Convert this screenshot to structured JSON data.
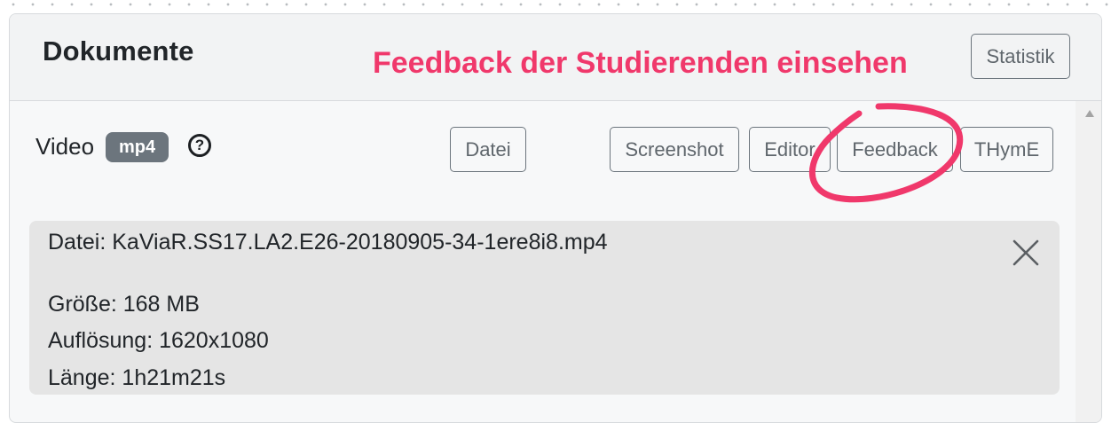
{
  "header": {
    "title": "Dokumente",
    "statistik_label": "Statistik"
  },
  "annotation": {
    "text": "Feedback der Studierenden einsehen",
    "color": "#f0386b"
  },
  "media": {
    "label": "Video",
    "badge": "mp4",
    "help_symbol": "?"
  },
  "buttons": {
    "datei": "Datei",
    "screenshot": "Screenshot",
    "editor": "Editor",
    "feedback": "Feedback",
    "thyme": "THymE"
  },
  "file_info": {
    "filename": "Datei: KaViaR.SS17.LA2.E26-20180905-34-1ere8i8.mp4",
    "size": "Größe: 168 MB",
    "resolution": "Auflösung: 1620x1080",
    "length": "Länge: 1h21m21s"
  },
  "icons": {
    "close": "close-icon",
    "help": "question-circle-icon",
    "scroll_up": "scroll-up-arrow-icon"
  },
  "colors": {
    "secondary": "#6c757d",
    "card_bg": "#f7f8f9",
    "info_bg": "#e5e5e5"
  }
}
